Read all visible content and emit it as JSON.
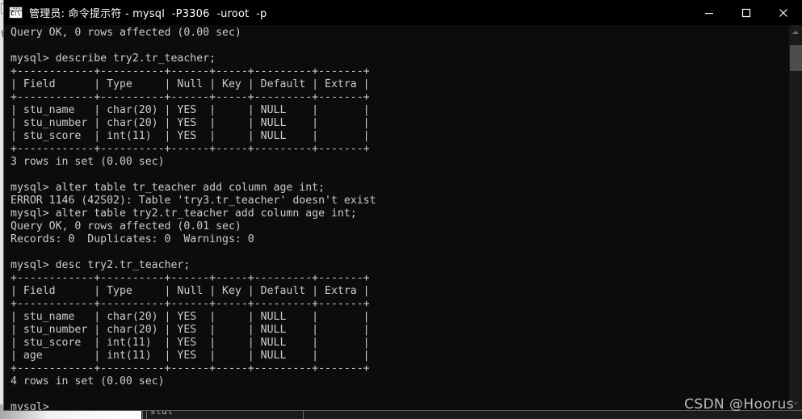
{
  "window": {
    "title": "管理员: 命令提示符 - mysql  -P3306  -uroot  -p",
    "icon": "console-icon",
    "icon_prompt_text": "C:\\",
    "controls": {
      "minimize": "minimize-icon",
      "maximize": "maximize-icon",
      "close": "close-icon"
    }
  },
  "terminal": {
    "background_color": "#0c0c0c",
    "text_color": "#cccccc",
    "prompt": "mysql>",
    "content": "Query OK, 0 rows affected (0.00 sec)\n\nmysql> describe try2.tr_teacher;\n+------------+----------+------+-----+---------+-------+\n| Field      | Type     | Null | Key | Default | Extra |\n+------------+----------+------+-----+---------+-------+\n| stu_name   | char(20) | YES  |     | NULL    |       |\n| stu_number | char(20) | YES  |     | NULL    |       |\n| stu_score  | int(11)  | YES  |     | NULL    |       |\n+------------+----------+------+-----+---------+-------+\n3 rows in set (0.00 sec)\n\nmysql> alter table tr_teacher add column age int;\nERROR 1146 (42S02): Table 'try3.tr_teacher' doesn't exist\nmysql> alter table try2.tr_teacher add column age int;\nQuery OK, 0 rows affected (0.01 sec)\nRecords: 0  Duplicates: 0  Warnings: 0\n\nmysql> desc try2.tr_teacher;\n+------------+----------+------+-----+---------+-------+\n| Field      | Type     | Null | Key | Default | Extra |\n+------------+----------+------+-----+---------+-------+\n| stu_name   | char(20) | YES  |     | NULL    |       |\n| stu_number | char(20) | YES  |     | NULL    |       |\n| stu_score  | int(11)  | YES  |     | NULL    |       |\n| age        | int(11)  | YES  |     | NULL    |       |\n+------------+----------+------+-----+---------+-------+\n4 rows in set (0.00 sec)\n\nmysql>",
    "commands": [
      "describe try2.tr_teacher;",
      "alter table tr_teacher add column age int;",
      "alter table try2.tr_teacher add column age int;",
      "desc try2.tr_teacher;"
    ],
    "messages": [
      "Query OK, 0 rows affected (0.00 sec)",
      "3 rows in set (0.00 sec)",
      "ERROR 1146 (42S02): Table 'try3.tr_teacher' doesn't exist",
      "Query OK, 0 rows affected (0.01 sec)",
      "Records: 0  Duplicates: 0  Warnings: 0",
      "4 rows in set (0.00 sec)"
    ],
    "tables": [
      {
        "name": "describe try2.tr_teacher",
        "columns": [
          "Field",
          "Type",
          "Null",
          "Key",
          "Default",
          "Extra"
        ],
        "rows": [
          [
            "stu_name",
            "char(20)",
            "YES",
            "",
            "NULL",
            ""
          ],
          [
            "stu_number",
            "char(20)",
            "YES",
            "",
            "NULL",
            ""
          ],
          [
            "stu_score",
            "int(11)",
            "YES",
            "",
            "NULL",
            ""
          ]
        ],
        "row_count": "3 rows in set (0.00 sec)"
      },
      {
        "name": "desc try2.tr_teacher",
        "columns": [
          "Field",
          "Type",
          "Null",
          "Key",
          "Default",
          "Extra"
        ],
        "rows": [
          [
            "stu_name",
            "char(20)",
            "YES",
            "",
            "NULL",
            ""
          ],
          [
            "stu_number",
            "char(20)",
            "YES",
            "",
            "NULL",
            ""
          ],
          [
            "stu_score",
            "int(11)",
            "YES",
            "",
            "NULL",
            ""
          ],
          [
            "age",
            "int(11)",
            "YES",
            "",
            "NULL",
            ""
          ]
        ],
        "row_count": "4 rows in set (0.00 sec)"
      }
    ]
  },
  "scrollbar": {
    "up_arrow": "chevron-up-icon",
    "down_arrow": "chevron-down-icon"
  },
  "background_windows": {
    "left_strip_glyph": "管",
    "bottom_cell_label": "stdl"
  },
  "watermark": {
    "text": "CSDN @Hoorus"
  }
}
